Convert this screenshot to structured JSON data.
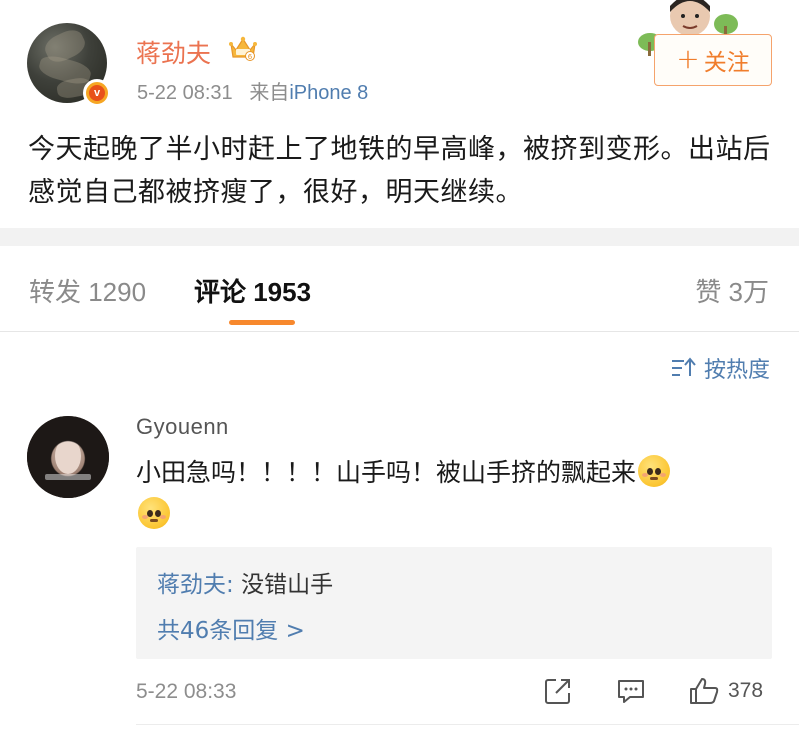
{
  "post": {
    "username": "蒋劲夫",
    "time": "5-22 08:31",
    "source_prefix": "来自",
    "device": "iPhone 8",
    "follow_label": "关注",
    "text": "今天起晚了半小时赶上了地铁的早高峰，被挤到变形。出站后感觉自己都被挤瘦了，很好，明天继续。",
    "badge_letter": "v"
  },
  "tabs": {
    "repost_label": "转发 1290",
    "comment_label": "评论 1953",
    "like_label": "赞 3万"
  },
  "sort": {
    "label": "按热度"
  },
  "comment": {
    "author": "Gyouenn",
    "text": "小田急吗！！！！山手吗！被山手挤的飘起来",
    "time": "5-22 08:33",
    "like_count": "378",
    "reply": {
      "author": "蒋劲夫",
      "separator": ": ",
      "text": "没错山手",
      "more_label": "共46条回复 >"
    }
  },
  "colors": {
    "accent_orange": "#f7882d",
    "username_orange": "#eb7350",
    "link_blue": "#507daf",
    "muted_gray": "#8d8d8d"
  },
  "icons": [
    "crown-icon",
    "verified-badge-icon",
    "plus-icon",
    "sort-icon",
    "share-icon",
    "comment-icon",
    "thumbs-up-icon",
    "emoji-blush-icon"
  ]
}
